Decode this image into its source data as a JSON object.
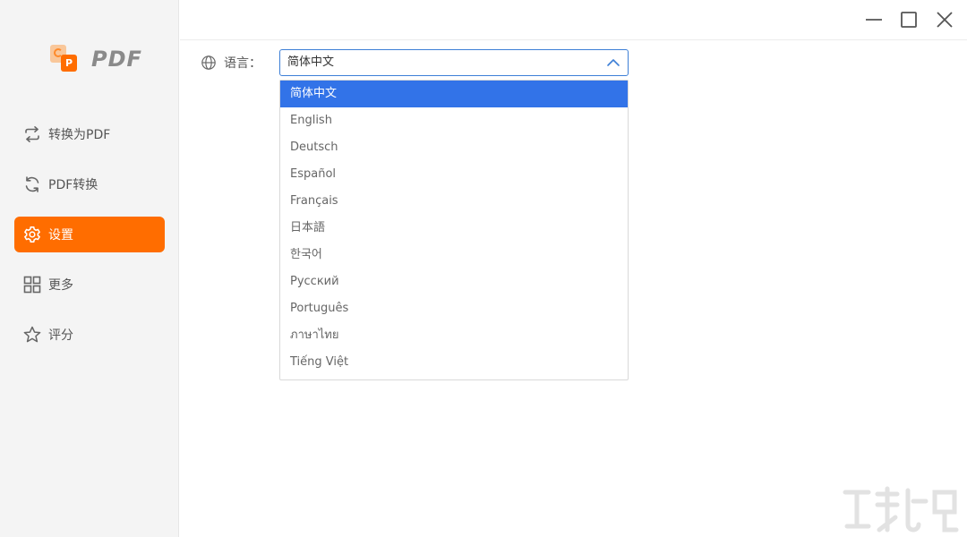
{
  "app": {
    "logo_text": "PDF",
    "logo_glyph": "P"
  },
  "sidebar": {
    "items": [
      {
        "label": "转换为PDF",
        "icon": "swap-arrows-icon",
        "active": false
      },
      {
        "label": "PDF转换",
        "icon": "refresh-icon",
        "active": false
      },
      {
        "label": "设置",
        "icon": "gear-icon",
        "active": true
      },
      {
        "label": "更多",
        "icon": "grid-icon",
        "active": false
      },
      {
        "label": "评分",
        "icon": "star-icon",
        "active": false
      }
    ]
  },
  "window_controls": [
    "minimize-icon",
    "maximize-icon",
    "close-icon"
  ],
  "settings": {
    "language_label": "语言：",
    "language_selected": "简体中文",
    "language_options": [
      "简体中文",
      "English",
      "Deutsch",
      "Español",
      "Français",
      "日本語",
      "한국어",
      "Русский",
      "Português",
      "ภาษาไทย",
      "Tiếng Việt"
    ]
  },
  "colors": {
    "accent": "#ff6d00",
    "select_border": "#3d7fd6",
    "option_highlight": "#3273e8",
    "sidebar_bg": "#f4f4f4"
  }
}
